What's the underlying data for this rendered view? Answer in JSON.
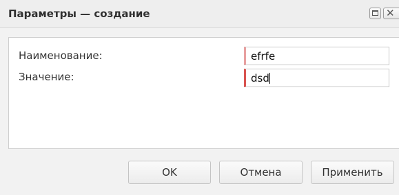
{
  "dialog": {
    "title": "Параметры — создание",
    "maximize_icon": "maximize-icon",
    "close_icon": "close-icon"
  },
  "form": {
    "name_label": "Наименование:",
    "name_value": "efrfe",
    "value_label": "Значение:",
    "value_value": "dsd"
  },
  "buttons": {
    "ok_label": "OK",
    "cancel_label": "Отмена",
    "apply_label": "Применить"
  },
  "colors": {
    "required_marker": "#d9534f",
    "titlebar_bg": "#eeeeee",
    "dialog_bg": "#f2f2f2"
  }
}
